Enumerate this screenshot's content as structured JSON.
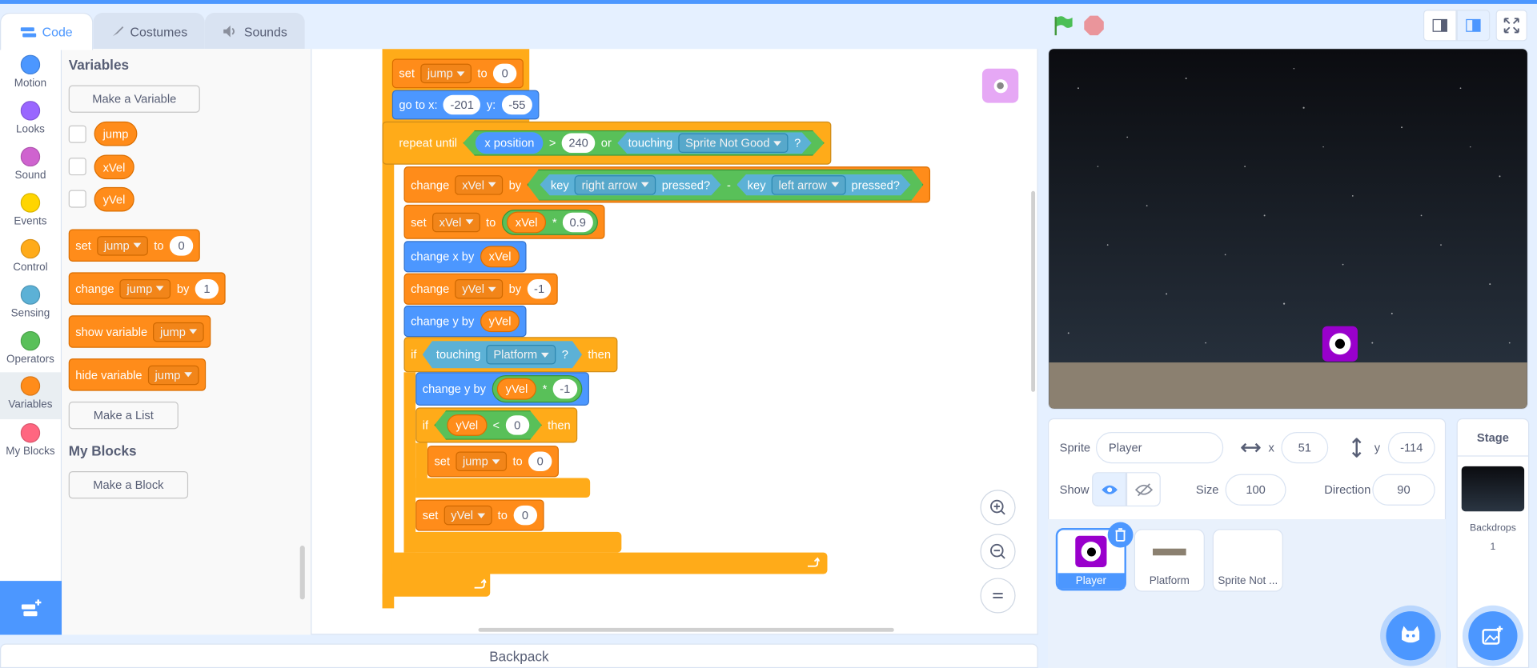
{
  "tabs": {
    "code": "Code",
    "costumes": "Costumes",
    "sounds": "Sounds"
  },
  "categories": [
    {
      "label": "Motion",
      "color": "#4c97ff"
    },
    {
      "label": "Looks",
      "color": "#9966ff"
    },
    {
      "label": "Sound",
      "color": "#cf63cf"
    },
    {
      "label": "Events",
      "color": "#ffd500"
    },
    {
      "label": "Control",
      "color": "#ffab19"
    },
    {
      "label": "Sensing",
      "color": "#5cb1d6"
    },
    {
      "label": "Operators",
      "color": "#59c059"
    },
    {
      "label": "Variables",
      "color": "#ff8c1a"
    },
    {
      "label": "My Blocks",
      "color": "#ff6680"
    }
  ],
  "palette": {
    "heading_variables": "Variables",
    "make_variable": "Make a Variable",
    "variables": [
      "jump",
      "xVel",
      "yVel"
    ],
    "set_block": {
      "op": "set",
      "var": "jump",
      "to": "to",
      "val": "0"
    },
    "change_block": {
      "op": "change",
      "var": "jump",
      "by": "by",
      "val": "1"
    },
    "show_block": {
      "op": "show variable",
      "var": "jump"
    },
    "hide_block": {
      "op": "hide variable",
      "var": "jump"
    },
    "make_list": "Make a List",
    "heading_myblocks": "My Blocks",
    "make_block": "Make a Block"
  },
  "script": {
    "set1": {
      "op": "set",
      "var": "jump",
      "to": "to",
      "val": "0"
    },
    "goto": {
      "op": "go to x:",
      "x": "-201",
      "ylbl": "y:",
      "y": "-55"
    },
    "repeat": {
      "op": "repeat until",
      "xpos": "x position",
      "gt": ">",
      "val": "240",
      "or": "or",
      "touching": "touching",
      "target": "Sprite Not Good",
      "q": "?"
    },
    "change_xvel": {
      "op": "change",
      "var": "xVel",
      "by": "by",
      "key": "key",
      "right": "right arrow",
      "pressed": "pressed?",
      "minus": "-",
      "left": "left arrow"
    },
    "set_xvel": {
      "op": "set",
      "var": "xVel",
      "to": "to",
      "rep": "xVel",
      "mul": "*",
      "val": "0.9"
    },
    "change_x": {
      "op": "change x by",
      "rep": "xVel"
    },
    "change_yvel": {
      "op": "change",
      "var": "yVel",
      "by": "by",
      "val": "-1"
    },
    "change_y": {
      "op": "change y by",
      "rep": "yVel"
    },
    "if1": {
      "op": "if",
      "touching": "touching",
      "target": "Platform",
      "q": "?",
      "then": "then"
    },
    "change_y2": {
      "op": "change y by",
      "rep": "yVel",
      "mul": "*",
      "val": "-1"
    },
    "if2": {
      "op": "if",
      "rep": "yVel",
      "lt": "<",
      "val": "0",
      "then": "then"
    },
    "set_jump": {
      "op": "set",
      "var": "jump",
      "to": "to",
      "val": "0"
    },
    "set_yvel": {
      "op": "set",
      "var": "yVel",
      "to": "to",
      "val": "0"
    }
  },
  "backpack": "Backpack",
  "sprite_info": {
    "sprite_label": "Sprite",
    "name": "Player",
    "x_label": "x",
    "x": "51",
    "y_label": "y",
    "y": "-114",
    "show_label": "Show",
    "size_label": "Size",
    "size": "100",
    "direction_label": "Direction",
    "direction": "90"
  },
  "sprites": [
    "Player",
    "Platform",
    "Sprite Not ..."
  ],
  "stage_panel": {
    "title": "Stage",
    "backdrops_label": "Backdrops",
    "backdrops_count": "1"
  },
  "colors": {
    "accent": "#4c97ff",
    "variables": "#ff8c1a",
    "control": "#ffab19",
    "operators": "#59c059",
    "sensing": "#5cb1d6"
  }
}
